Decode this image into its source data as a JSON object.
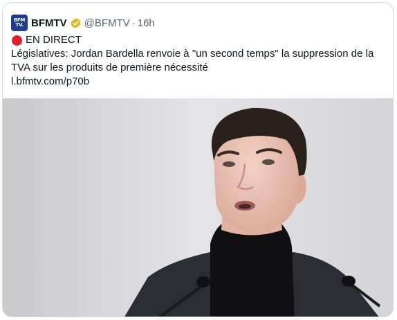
{
  "tweet": {
    "avatar_text": [
      "BFM",
      "TV."
    ],
    "display_name": "BFMTV",
    "handle": "@BFMTV",
    "separator": "·",
    "time": "16h",
    "live_label": "EN DIRECT",
    "text": "Législatives: Jordan Bardella renvoie à \"un second temps\" la suppression de la TVA sur les produits de première nécessité",
    "link": "l.bfmtv.com/p70b"
  },
  "colors": {
    "avatar_bg": "#1f3d8a",
    "verified": "#e2b719",
    "live_dot": "#e0202b",
    "handle": "#536471"
  }
}
